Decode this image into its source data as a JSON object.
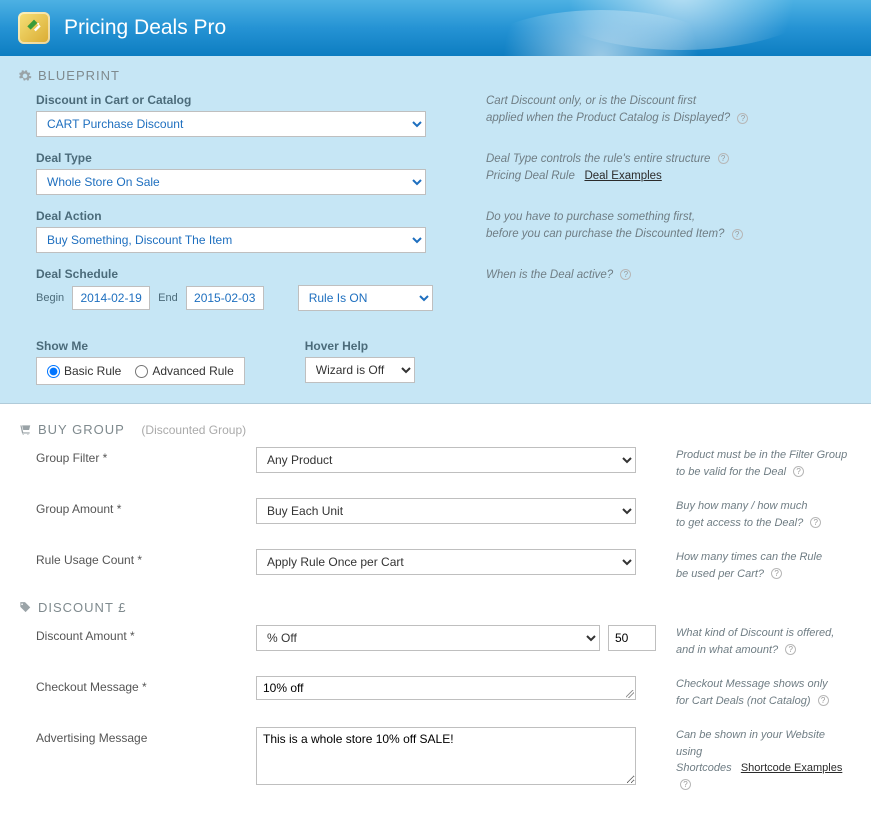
{
  "header": {
    "title": "Pricing Deals Pro"
  },
  "blueprint": {
    "section_label": "BLUEPRINT",
    "discount_in": {
      "label": "Discount in Cart or Catalog",
      "value": "CART Purchase Discount",
      "hint1": "Cart Discount only, or is the Discount first",
      "hint2": "applied when the Product Catalog is Displayed?"
    },
    "deal_type": {
      "label": "Deal Type",
      "value": "Whole Store On Sale",
      "hint1": "Deal Type controls the rule's entire structure",
      "hint2": "Pricing Deal Rule",
      "link": "Deal Examples"
    },
    "deal_action": {
      "label": "Deal Action",
      "value": "Buy Something, Discount The Item",
      "hint1": "Do you have to purchase something first,",
      "hint2": "before you can purchase the Discounted Item?"
    },
    "deal_schedule": {
      "label": "Deal Schedule",
      "begin_label": "Begin",
      "begin": "2014-02-19",
      "end_label": "End",
      "end": "2015-02-03",
      "status": "Rule Is ON",
      "hint": "When is the Deal active?"
    },
    "show_me": {
      "label": "Show Me",
      "basic": "Basic Rule",
      "advanced": "Advanced Rule"
    },
    "hover_help": {
      "label": "Hover Help",
      "value": "Wizard is Off"
    }
  },
  "buy_group": {
    "section_label": "BUY GROUP",
    "section_sub": "(Discounted Group)",
    "filter": {
      "label": "Group Filter *",
      "value": "Any Product",
      "hint1": "Product must be in the Filter Group",
      "hint2": "to be valid for the Deal"
    },
    "amount": {
      "label": "Group Amount *",
      "value": "Buy Each Unit",
      "hint1": "Buy how many / how much",
      "hint2": "to get access to the Deal?"
    },
    "usage": {
      "label": "Rule Usage Count *",
      "value": "Apply Rule Once per Cart",
      "hint1": "How many times can the Rule",
      "hint2": "be used per Cart?"
    }
  },
  "discount": {
    "section_label": "DISCOUNT £",
    "amount": {
      "label": "Discount Amount *",
      "type": "% Off",
      "value": "50",
      "hint1": "What kind of Discount is offered,",
      "hint2": "and in what amount?"
    },
    "checkout": {
      "label": "Checkout Message *",
      "value": "10% off",
      "hint1": "Checkout Message shows only",
      "hint2": "for Cart Deals (not Catalog)"
    },
    "advertising": {
      "label": "Advertising Message",
      "value": "This is a whole store 10% off SALE!",
      "hint1": "Can be shown in your Website using",
      "hint2": "Shortcodes",
      "link": "Shortcode Examples"
    }
  }
}
